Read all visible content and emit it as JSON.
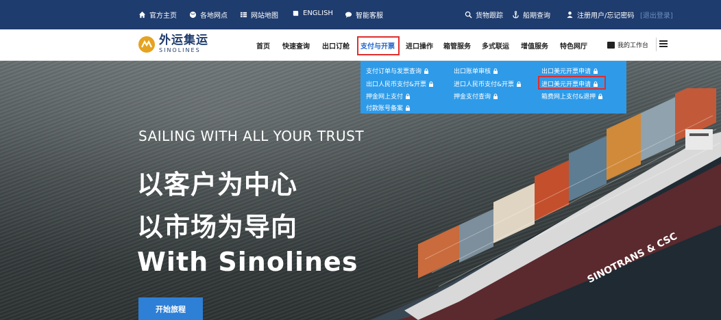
{
  "topbar": {
    "items": [
      {
        "label": "官方主页",
        "icon": "home-icon"
      },
      {
        "label": "各地网点",
        "icon": "globe-icon"
      },
      {
        "label": "网站地图",
        "icon": "grid-icon"
      },
      {
        "label": "ENGLISH",
        "icon": "book-icon"
      },
      {
        "label": "智能客服",
        "icon": "chat-icon"
      }
    ],
    "right": [
      {
        "label": "货物跟踪",
        "icon": "search-icon"
      },
      {
        "label": "船期查询",
        "icon": "anchor-icon"
      },
      {
        "label": "注册用户/忘记密码",
        "icon": "user-icon"
      },
      {
        "label": "[退出登录]",
        "icon": ""
      }
    ]
  },
  "logo": {
    "cn": "外运集运",
    "en": "SINOLINES"
  },
  "nav": {
    "items": [
      "首页",
      "快速查询",
      "出口订舱",
      "支付与开票",
      "进口操作",
      "箱管服务",
      "多式联运",
      "增值服务",
      "特色网厅"
    ],
    "active_index": 3,
    "workbench": "我的工作台"
  },
  "dropdown": {
    "items": [
      "支付订单与发票查询",
      "出口账单审核",
      "出口美元开票申请",
      "出口人民币支付&开票",
      "进口人民币支付&开票",
      "进口美元开票申请",
      "押金网上支付",
      "押金支付查询",
      "箱费网上支付&退押",
      "付款账号备案"
    ]
  },
  "hero": {
    "subtitle": "SAILING WITH ALL YOUR TRUST",
    "line1": "以客户为中心",
    "line2": "以市场为导向",
    "line3": "With Sinolines",
    "cta": "开始旅程"
  },
  "ship": {
    "hull_text": "SINOTRANS & CSC"
  },
  "colors": {
    "topbar": "#1f3c6e",
    "dropdown": "#2f9be8",
    "accent": "#1f63c8",
    "cta": "#2e7fd6",
    "highlight": "#e02d2d"
  }
}
